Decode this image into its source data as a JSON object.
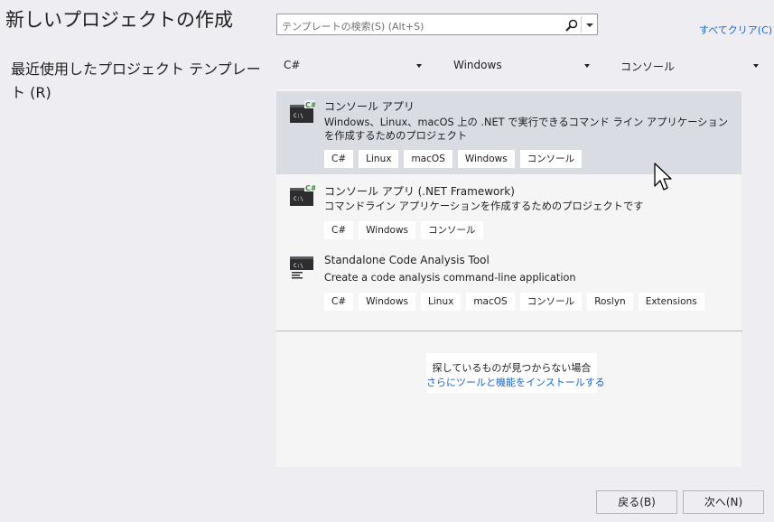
{
  "header": {
    "title": "新しいプロジェクトの作成",
    "recent_label": "最近使用したプロジェクト テンプレート (R)"
  },
  "search": {
    "placeholder": "テンプレートの検索(S) (Alt+S)",
    "icon": "search-icon"
  },
  "clear_all_label": "すべてクリア(C)",
  "filters": [
    {
      "label": "C#"
    },
    {
      "label": "Windows"
    },
    {
      "label": "コンソール"
    }
  ],
  "templates": [
    {
      "name": "コンソール アプリ",
      "description": "Windows、Linux、macOS 上の .NET で実行できるコマンド ライン アプリケーションを作成するためのプロジェクト",
      "tags": [
        "C#",
        "Linux",
        "macOS",
        "Windows",
        "コンソール"
      ],
      "icon": "console-app-icon",
      "badge": "C#",
      "selected": true
    },
    {
      "name": "コンソール アプリ (.NET Framework)",
      "description": "コマンドライン アプリケーションを作成するためのプロジェクトです",
      "tags": [
        "C#",
        "Windows",
        "コンソール"
      ],
      "icon": "console-app-icon",
      "badge": "C#",
      "selected": false
    },
    {
      "name": "Standalone Code Analysis Tool",
      "description": "Create a code analysis command-line application",
      "tags": [
        "C#",
        "Windows",
        "Linux",
        "macOS",
        "コンソール",
        "Roslyn",
        "Extensions"
      ],
      "icon": "code-analysis-tool-icon",
      "selected": false
    }
  ],
  "not_found": {
    "text": "探しているものが見つからない場合",
    "link": "さらにツールと機能をインストールする"
  },
  "buttons": {
    "back": "戻る(B)",
    "next": "次へ(N)"
  },
  "colors": {
    "background": "#eeeef2",
    "selected_row": "#dadce4",
    "link": "#1a66c8",
    "csharp_badge": "#388a34"
  }
}
